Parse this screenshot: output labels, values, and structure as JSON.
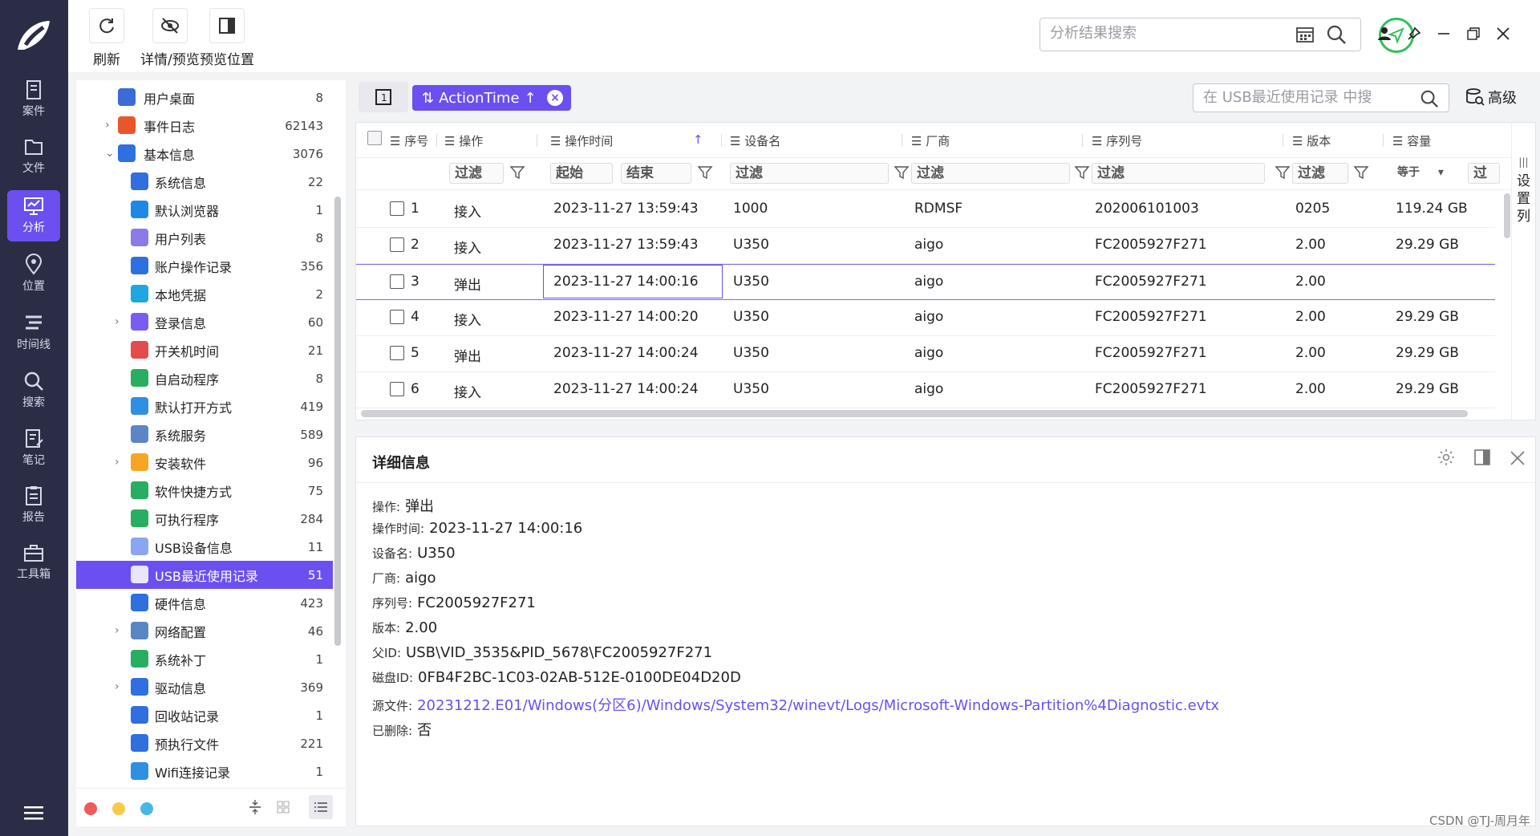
{
  "nav": {
    "items": [
      {
        "label": "案件",
        "icon": "case-icon"
      },
      {
        "label": "文件",
        "icon": "folder-icon"
      },
      {
        "label": "分析",
        "icon": "analysis-icon",
        "active": true
      },
      {
        "label": "位置",
        "icon": "location-icon"
      },
      {
        "label": "时间线",
        "icon": "timeline-icon"
      },
      {
        "label": "搜索",
        "icon": "search-icon"
      },
      {
        "label": "笔记",
        "icon": "note-icon"
      },
      {
        "label": "报告",
        "icon": "report-icon"
      },
      {
        "label": "工具箱",
        "icon": "toolbox-icon"
      }
    ]
  },
  "toolbar": {
    "refresh": "刷新",
    "detail_preview": "详情/预览",
    "preview_position": "预览位置",
    "search_placeholder": "分析结果搜索"
  },
  "tree": {
    "items": [
      {
        "label": "用户桌面",
        "count": "8",
        "level": 0,
        "caret": "",
        "icon": "desktop-icon",
        "color": "#3a6bd6"
      },
      {
        "label": "事件日志",
        "count": "62143",
        "level": 0,
        "caret": ">",
        "icon": "event-log-icon",
        "color": "#e8572b"
      },
      {
        "label": "基本信息",
        "count": "3076",
        "level": 0,
        "caret": "v",
        "icon": "basic-info-icon",
        "color": "#2f6fe0"
      },
      {
        "label": "系统信息",
        "count": "22",
        "level": 1,
        "caret": "",
        "icon": "system-info-icon",
        "color": "#2f6fe0"
      },
      {
        "label": "默认浏览器",
        "count": "1",
        "level": 1,
        "caret": "",
        "icon": "browser-icon",
        "color": "#1e88e5"
      },
      {
        "label": "用户列表",
        "count": "8",
        "level": 1,
        "caret": "",
        "icon": "user-list-icon",
        "color": "#8c7ae6"
      },
      {
        "label": "账户操作记录",
        "count": "356",
        "level": 1,
        "caret": "",
        "icon": "account-log-icon",
        "color": "#2f6fe0"
      },
      {
        "label": "本地凭据",
        "count": "2",
        "level": 1,
        "caret": "",
        "icon": "credential-icon",
        "color": "#1ea7e0"
      },
      {
        "label": "登录信息",
        "count": "60",
        "level": 1,
        "caret": ">",
        "icon": "login-icon",
        "color": "#7a5cf0"
      },
      {
        "label": "开关机时间",
        "count": "21",
        "level": 1,
        "caret": "",
        "icon": "power-icon",
        "color": "#e54b4b"
      },
      {
        "label": "自启动程序",
        "count": "8",
        "level": 1,
        "caret": "",
        "icon": "autostart-icon",
        "color": "#27ae60"
      },
      {
        "label": "默认打开方式",
        "count": "419",
        "level": 1,
        "caret": "",
        "icon": "open-with-icon",
        "color": "#2f8fe0"
      },
      {
        "label": "系统服务",
        "count": "589",
        "level": 1,
        "caret": "",
        "icon": "service-icon",
        "color": "#5b86c4"
      },
      {
        "label": "安装软件",
        "count": "96",
        "level": 1,
        "caret": ">",
        "icon": "installed-software-icon",
        "color": "#f5a623"
      },
      {
        "label": "软件快捷方式",
        "count": "75",
        "level": 1,
        "caret": "",
        "icon": "shortcut-icon",
        "color": "#27ae60"
      },
      {
        "label": "可执行程序",
        "count": "284",
        "level": 1,
        "caret": "",
        "icon": "executable-icon",
        "color": "#27ae60"
      },
      {
        "label": "USB设备信息",
        "count": "11",
        "level": 1,
        "caret": "",
        "icon": "usb-device-icon",
        "color": "#8aa6f0"
      },
      {
        "label": "USB最近使用记录",
        "count": "51",
        "level": 1,
        "caret": "",
        "icon": "usb-recent-icon",
        "color": "#8aa6f0",
        "active": true
      },
      {
        "label": "硬件信息",
        "count": "423",
        "level": 1,
        "caret": "",
        "icon": "hardware-icon",
        "color": "#2f6fe0"
      },
      {
        "label": "网络配置",
        "count": "46",
        "level": 1,
        "caret": ">",
        "icon": "network-icon",
        "color": "#5b86c4"
      },
      {
        "label": "系统补丁",
        "count": "1",
        "level": 1,
        "caret": "",
        "icon": "patch-icon",
        "color": "#27ae60"
      },
      {
        "label": "驱动信息",
        "count": "369",
        "level": 1,
        "caret": ">",
        "icon": "driver-icon",
        "color": "#2f6fe0"
      },
      {
        "label": "回收站记录",
        "count": "1",
        "level": 1,
        "caret": "",
        "icon": "recycle-bin-icon",
        "color": "#2f6fe0"
      },
      {
        "label": "预执行文件",
        "count": "221",
        "level": 1,
        "caret": "",
        "icon": "prefetch-icon",
        "color": "#2f6fe0"
      },
      {
        "label": "Wifi连接记录",
        "count": "1",
        "level": 1,
        "caret": "",
        "icon": "wifi-icon",
        "color": "#2f8fe0"
      }
    ]
  },
  "grid_bar": {
    "one_button": "1",
    "sort_label": "ActionTime",
    "search_placeholder": "在 USB最近使用记录 中搜",
    "advanced": "高级"
  },
  "grid": {
    "columns": [
      "序号",
      "操作",
      "操作时间",
      "设备名",
      "厂商",
      "序列号",
      "版本",
      "容量"
    ],
    "filter_placeholder": "过滤",
    "filter_start": "起始",
    "filter_end": "结束",
    "filter_equals": "等于",
    "column_settings": "设置列",
    "rows": [
      {
        "no": "1",
        "action": "接入",
        "time": "2023-11-27 13:59:43",
        "device": "1000",
        "vendor": "RDMSF",
        "serial": "202006101003",
        "version": "0205",
        "capacity": "119.24 GB"
      },
      {
        "no": "2",
        "action": "接入",
        "time": "2023-11-27 13:59:43",
        "device": "U350",
        "vendor": "aigo",
        "serial": "FC2005927F271",
        "version": "2.00",
        "capacity": "29.29 GB"
      },
      {
        "no": "3",
        "action": "弹出",
        "time": "2023-11-27 14:00:16",
        "device": "U350",
        "vendor": "aigo",
        "serial": "FC2005927F271",
        "version": "2.00",
        "capacity": ""
      },
      {
        "no": "4",
        "action": "接入",
        "time": "2023-11-27 14:00:20",
        "device": "U350",
        "vendor": "aigo",
        "serial": "FC2005927F271",
        "version": "2.00",
        "capacity": "29.29 GB"
      },
      {
        "no": "5",
        "action": "弹出",
        "time": "2023-11-27 14:00:24",
        "device": "U350",
        "vendor": "aigo",
        "serial": "FC2005927F271",
        "version": "2.00",
        "capacity": "29.29 GB"
      },
      {
        "no": "6",
        "action": "接入",
        "time": "2023-11-27 14:00:24",
        "device": "U350",
        "vendor": "aigo",
        "serial": "FC2005927F271",
        "version": "2.00",
        "capacity": "29.29 GB"
      }
    ]
  },
  "detail": {
    "title": "详细信息",
    "fields": [
      {
        "key": "操作:",
        "value": "弹出"
      },
      {
        "key": "操作时间:",
        "value": "2023-11-27 14:00:16"
      },
      {
        "key": "设备名:",
        "value": "U350"
      },
      {
        "key": "厂商:",
        "value": "aigo"
      },
      {
        "key": "序列号:",
        "value": "FC2005927F271"
      },
      {
        "key": "版本:",
        "value": "2.00"
      },
      {
        "key": "父ID:",
        "value": "USB\\VID_3535&PID_5678\\FC2005927F271"
      },
      {
        "key": "磁盘ID:",
        "value": "0FB4F2BC-1C03-02AB-512E-0100DE04D20D"
      },
      {
        "key": "源文件:",
        "value": "20231212.E01/Windows(分区6)/Windows/System32/winevt/Logs/Microsoft-Windows-Partition%4Diagnostic.evtx",
        "link": true
      },
      {
        "key": "已删除:",
        "value": "否"
      }
    ]
  },
  "footer": {
    "dots": [
      "#f25a5a",
      "#f7c948",
      "#47b8e6"
    ]
  },
  "watermark": "CSDN @TJ-周月年",
  "colors": {
    "accent": "#6b4ff0",
    "nav_bg": "#2a2d45",
    "status_green": "#2fbf5a"
  }
}
